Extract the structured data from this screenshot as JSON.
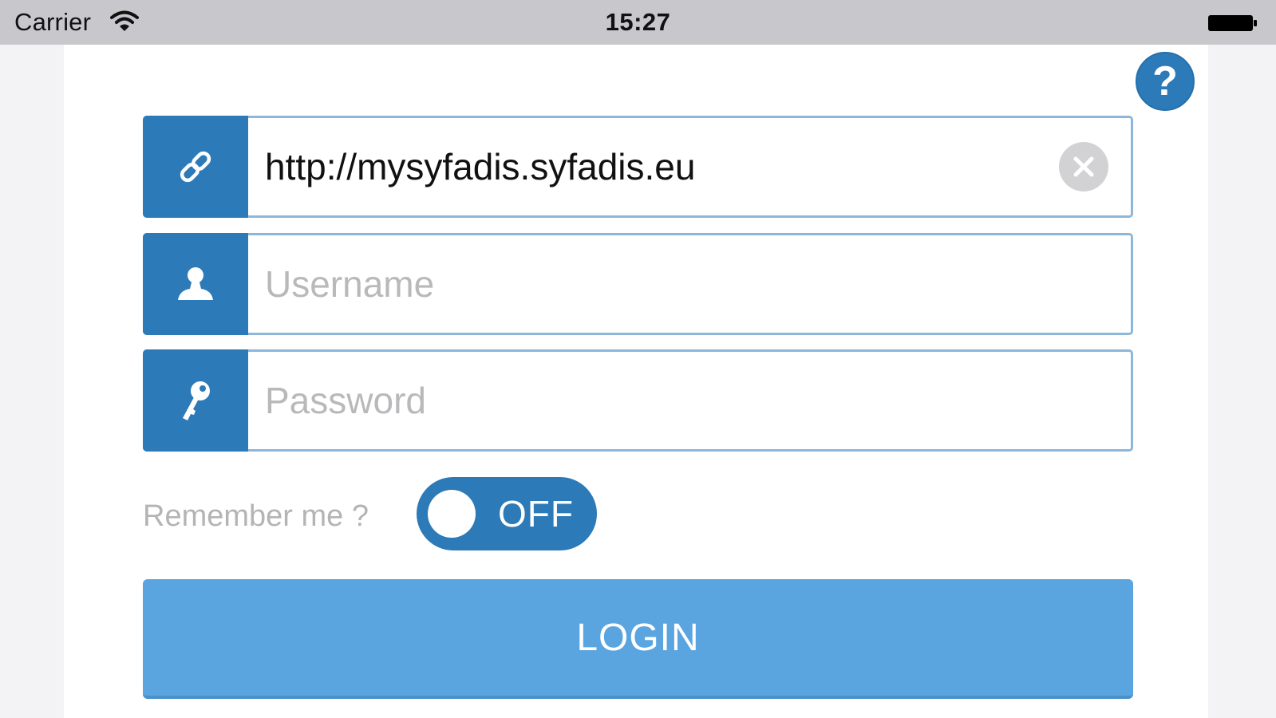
{
  "status_bar": {
    "carrier": "Carrier",
    "time": "15:27",
    "wifi_icon": "wifi-icon",
    "battery_icon": "battery-icon"
  },
  "help": {
    "label": "?",
    "icon": "help-icon"
  },
  "form": {
    "url": {
      "icon": "link-icon",
      "value": "http://mysyfadis.syfadis.eu",
      "clear_icon": "clear-icon"
    },
    "username": {
      "icon": "user-icon",
      "value": "",
      "placeholder": "Username"
    },
    "password": {
      "icon": "key-icon",
      "value": "",
      "placeholder": "Password"
    },
    "remember": {
      "label": "Remember me ?",
      "state": "OFF"
    },
    "login_label": "LOGIN"
  },
  "colors": {
    "primary": "#2d7ab8",
    "login_button": "#5aa4e0",
    "field_border": "#8db7da",
    "placeholder": "#b9b9bb",
    "status_bar": "#c8c8cc"
  }
}
